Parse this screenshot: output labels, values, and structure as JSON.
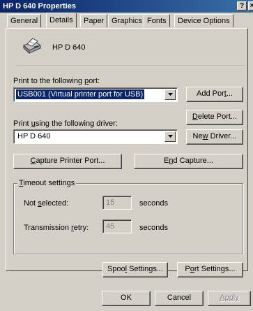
{
  "window": {
    "title": "HP D 640 Properties",
    "help_btn": "?",
    "close_btn": "×"
  },
  "tabs": [
    {
      "label": "General"
    },
    {
      "label": "Details"
    },
    {
      "label": "Paper"
    },
    {
      "label": "Graphics"
    },
    {
      "label": "Fonts"
    },
    {
      "label": "Device Options"
    }
  ],
  "printer": {
    "name": "HP D 640",
    "icon": "printer-icon"
  },
  "port": {
    "label_pre": "Print to the following ",
    "label_ul": "p",
    "label_post": "ort:",
    "value": "USB001  (Virtual printer port for USB)"
  },
  "add_port": {
    "pre": "Add Por",
    "ul": "t",
    "post": "..."
  },
  "delete_port": {
    "pre": "",
    "ul": "D",
    "post": "elete Port..."
  },
  "driver": {
    "label_pre": "Print ",
    "label_ul": "u",
    "label_post": "sing the following driver:",
    "value": "HP D 640"
  },
  "new_driver": {
    "pre": "Ne",
    "ul": "w",
    "post": " Driver..."
  },
  "capture": {
    "pre": "",
    "ul": "C",
    "post": "apture Printer Port..."
  },
  "end_capture": {
    "pre": "E",
    "ul": "n",
    "post": "d Capture..."
  },
  "timeout": {
    "title_pre": "",
    "title_ul": "T",
    "title_post": "imeout settings",
    "not_selected": {
      "pre": "Not ",
      "ul": "s",
      "post": "elected:",
      "value": "15",
      "unit": "seconds"
    },
    "retry": {
      "pre": "Transmission ",
      "ul": "r",
      "post": "etry:",
      "value": "45",
      "unit": "seconds"
    }
  },
  "spool": {
    "pre": "Spoo",
    "ul": "l",
    "post": " Settings..."
  },
  "port_settings": {
    "pre": "P",
    "ul": "o",
    "post": "rt Settings..."
  },
  "footer": {
    "ok": "OK",
    "cancel": "Cancel",
    "apply": "Apply"
  }
}
